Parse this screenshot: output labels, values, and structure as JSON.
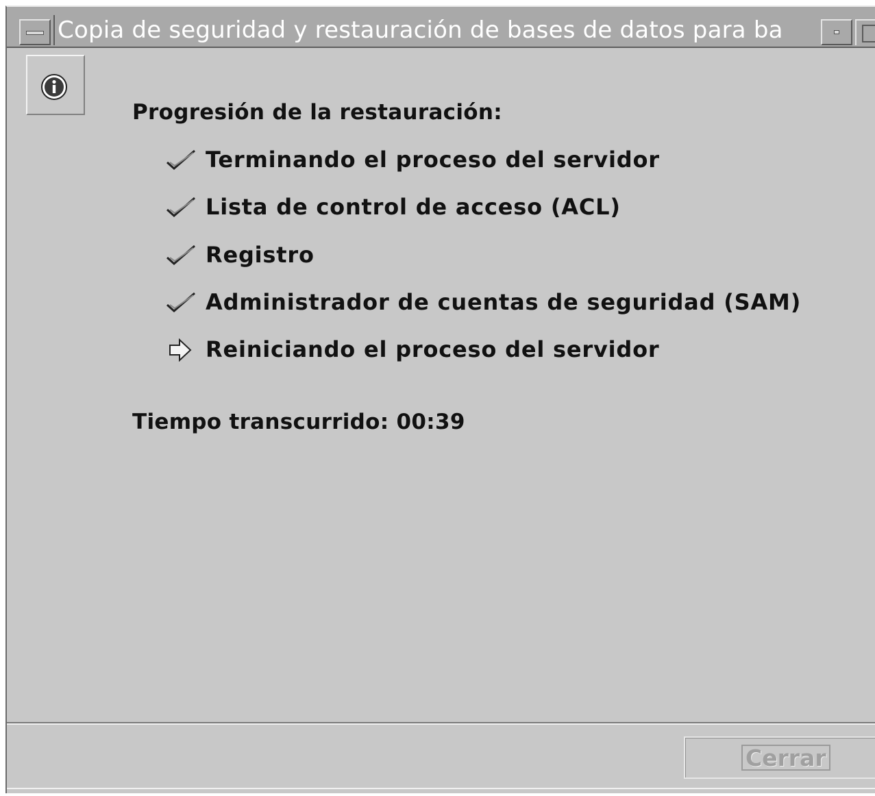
{
  "window": {
    "title": "Copia de seguridad y restauración de bases de datos para ba"
  },
  "icons": {
    "info": "info-icon",
    "done": "checkmark-icon",
    "current": "arrow-right-icon"
  },
  "main": {
    "heading": "Progresión de la restauración:",
    "steps": [
      {
        "label": "Terminando el proceso del servidor",
        "status": "done"
      },
      {
        "label": "Lista de control de acceso (ACL)",
        "status": "done"
      },
      {
        "label": "Registro",
        "status": "done"
      },
      {
        "label": "Administrador de cuentas de seguridad (SAM)",
        "status": "done"
      },
      {
        "label": "Reiniciando el proceso del servidor",
        "status": "in-progress"
      }
    ],
    "elapsed": "Tiempo transcurrido: 00:39"
  },
  "footer": {
    "close_label": "Cerrar",
    "close_enabled": false
  },
  "colors": {
    "background": "#c8c8c8",
    "titlebar": "#a9a9a9",
    "title_text": "#ffffff",
    "disabled_text": "#a0a0a0"
  }
}
